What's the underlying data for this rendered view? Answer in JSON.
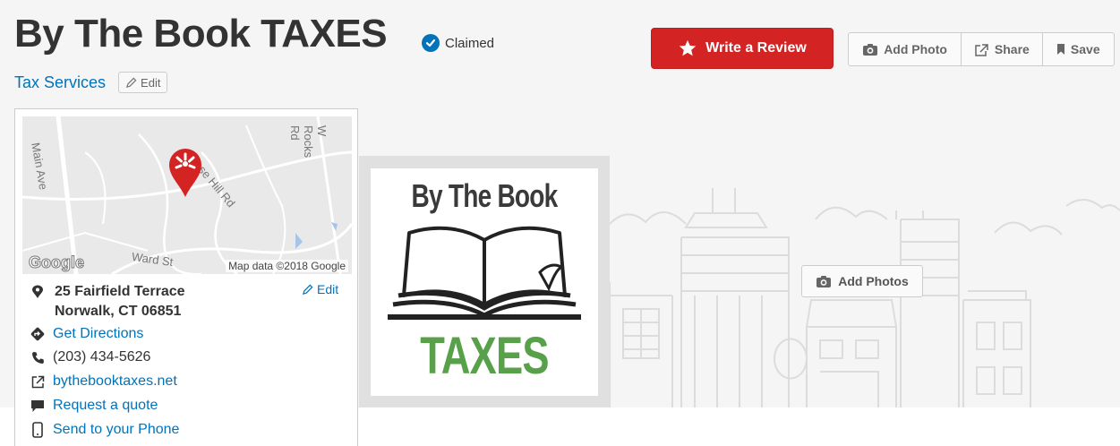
{
  "business": {
    "name": "By The Book TAXES",
    "claimed_label": "Claimed",
    "category": "Tax Services",
    "category_edit_label": "Edit"
  },
  "actions": {
    "write_review": "Write a Review",
    "add_photo": "Add Photo",
    "share": "Share",
    "save": "Save",
    "add_photos": "Add Photos"
  },
  "map": {
    "attribution": "Map data ©2018 Google",
    "provider": "Google",
    "street_labels": [
      "Main Ave",
      "W Rocks Rd",
      "se Hill Rd",
      "Ward St"
    ]
  },
  "contact": {
    "address_line1": "25 Fairfield Terrace",
    "address_line2": "Norwalk, CT 06851",
    "address_edit_label": "Edit",
    "directions": "Get Directions",
    "phone": "(203) 434-5626",
    "website": "bythebooktaxes.net",
    "quote": "Request a quote",
    "send_phone": "Send to your Phone"
  },
  "logo": {
    "top_text": "By The Book",
    "bottom_text": "TAXES"
  },
  "colors": {
    "brand_red": "#d32323",
    "link_blue": "#0073bb",
    "logo_green": "#58a14a"
  }
}
